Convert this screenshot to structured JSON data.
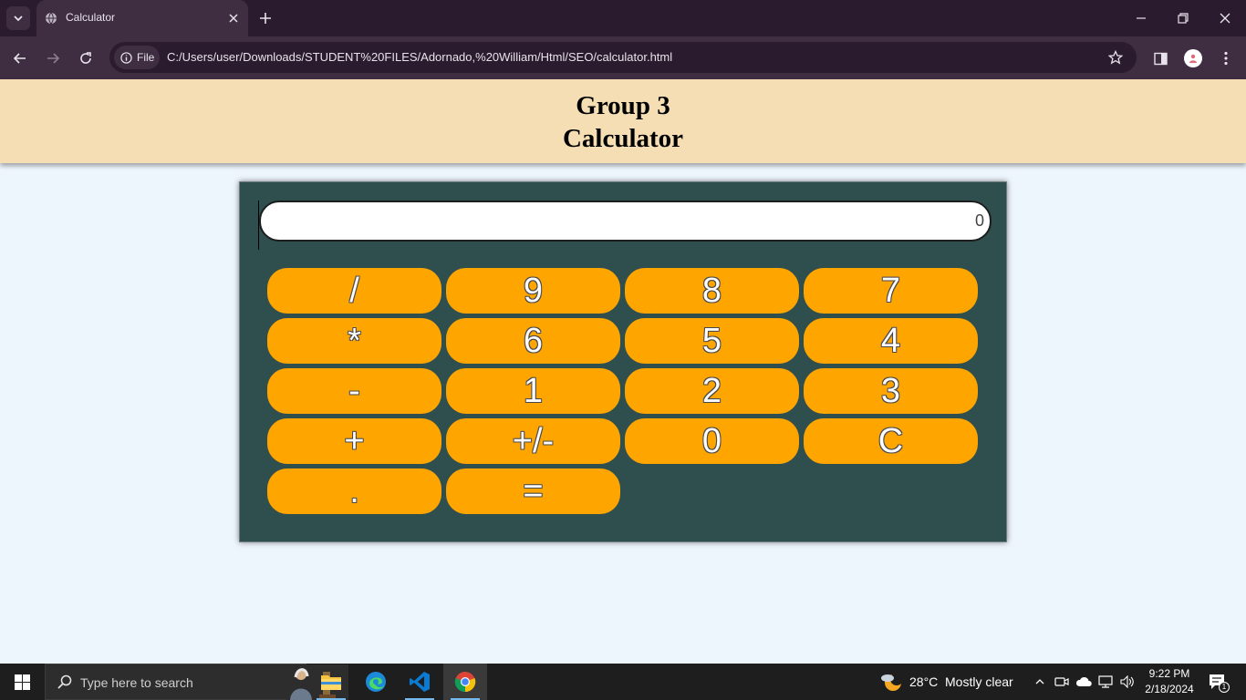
{
  "browser": {
    "tab_title": "Calculator",
    "site_chip_label": "File",
    "url": "C:/Users/user/Downloads/STUDENT%20FILES/Adornado,%20William/Html/SEO/calculator.html"
  },
  "page": {
    "title_line1": "Group 3",
    "title_line2": "Calculator"
  },
  "calculator": {
    "display_value": "0",
    "keys": [
      "/",
      "9",
      "8",
      "7",
      "*",
      "6",
      "5",
      "4",
      "-",
      "1",
      "2",
      "3",
      "+",
      "+/-",
      "0",
      "C",
      ".",
      "="
    ],
    "key_color": "#ffa500",
    "body_color": "#2f4f4f"
  },
  "taskbar": {
    "search_placeholder": "Type here to search",
    "weather_temp": "28°C",
    "weather_text": "Mostly clear",
    "time": "9:22 PM",
    "date": "2/18/2024",
    "notification_count": "1"
  },
  "colors": {
    "header_bg": "#f5deb3",
    "page_bg": "#eef6fd",
    "browser_frame": "#2b1b2e",
    "browser_toolbar": "#3f2d42"
  }
}
